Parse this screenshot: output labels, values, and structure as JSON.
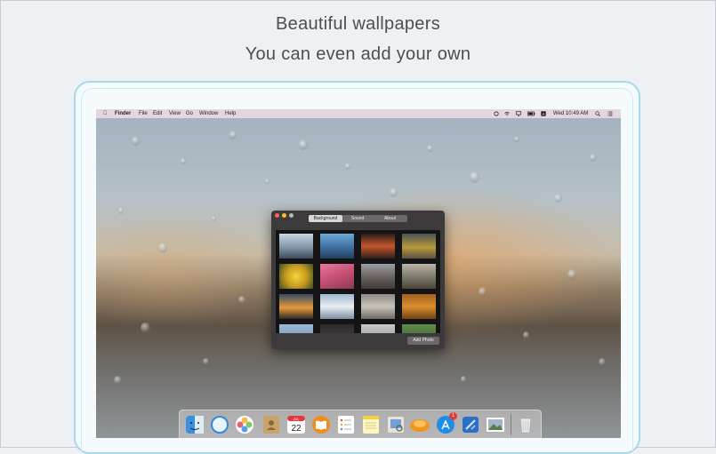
{
  "promo": {
    "headline": "Beautiful wallpapers",
    "subheadline": "You can even add your own"
  },
  "menubar": {
    "apple_icon": "apple-icon",
    "app_name": "Finder",
    "menus": [
      "File",
      "Edit",
      "View",
      "Go",
      "Window",
      "Help"
    ],
    "status_icons": [
      "creative-cloud-icon",
      "wifi-icon",
      "airplay-icon",
      "battery-icon",
      "text-input-icon"
    ],
    "clock": "Wed 10:49 AM",
    "right_icons": [
      "spotlight-icon",
      "notification-center-icon"
    ]
  },
  "app_window": {
    "tabs": [
      "Background",
      "Sound",
      "About"
    ],
    "active_tab": "Background",
    "add_photo_label": "Add Photo",
    "thumbnails": [
      "city-night-wallpaper",
      "skyline-blue-wallpaper",
      "market-night-wallpaper",
      "yellow-truck-wallpaper",
      "yellow-flowers-wallpaper",
      "pink-cliff-wallpaper",
      "street-crowd-wallpaper",
      "roof-tops-wallpaper",
      "sunset-lake-wallpaper",
      "snow-mountain-wallpaper",
      "stone-arches-wallpaper",
      "orange-fields-wallpaper",
      "sea-wallpaper",
      "dark-street-wallpaper",
      "grey-wallpaper",
      "green-wallpaper"
    ],
    "colors": {
      "close": "#ff5f57",
      "minimize": "#febc2e",
      "zoom": "#28c840"
    }
  },
  "dock": {
    "apps": [
      "finder-icon",
      "safari-icon",
      "photos-icon",
      "contacts-icon",
      "calendar-icon",
      "ibooks-icon",
      "reminders-icon",
      "notes-icon",
      "preview-icon",
      "wallpaper-app-icon",
      "app-store-icon",
      "xcode-icon",
      "image-viewer-icon",
      "trash-icon"
    ],
    "calendar": {
      "month": "JUL",
      "day": "22"
    },
    "app_store_badge": "1"
  }
}
